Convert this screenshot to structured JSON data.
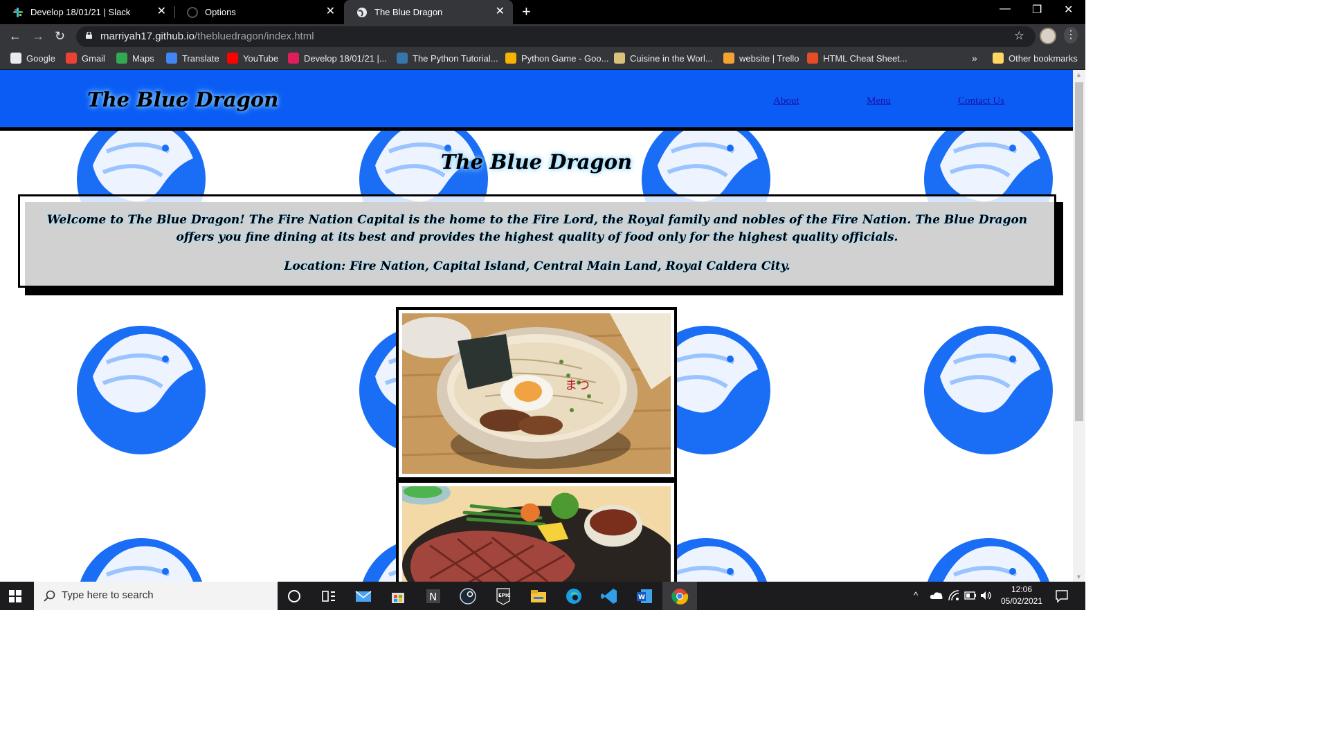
{
  "browser": {
    "tabs": [
      {
        "title": "Develop 18/01/21 | Slack",
        "active": false
      },
      {
        "title": "Options",
        "active": false
      },
      {
        "title": "The Blue Dragon",
        "active": true
      }
    ],
    "url_host": "marriyah17.github.io",
    "url_path": "/thebluedragon/index.html",
    "bookmarks": [
      {
        "label": "Google",
        "icon": "google-icon",
        "color": "#e8eaed"
      },
      {
        "label": "Gmail",
        "icon": "gmail-icon",
        "color": "#ea4335"
      },
      {
        "label": "Maps",
        "icon": "maps-icon",
        "color": "#34a853"
      },
      {
        "label": "Translate",
        "icon": "translate-icon",
        "color": "#4285f4"
      },
      {
        "label": "YouTube",
        "icon": "youtube-icon",
        "color": "#ff0000"
      },
      {
        "label": "Develop 18/01/21 |...",
        "icon": "slack-icon",
        "color": "#e01e5a"
      },
      {
        "label": "The Python Tutorial...",
        "icon": "python-icon",
        "color": "#3776ab"
      },
      {
        "label": "Python Game - Goo...",
        "icon": "slides-icon",
        "color": "#f4b400"
      },
      {
        "label": "Cuisine in the Worl...",
        "icon": "wiki-icon",
        "color": "#d9c37a"
      },
      {
        "label": "website | Trello",
        "icon": "trello-icon",
        "color": "#f4a233"
      },
      {
        "label": "HTML Cheat Sheet...",
        "icon": "html-icon",
        "color": "#e44d26"
      }
    ],
    "more_bookmarks": "»",
    "other_bookmarks": "Other bookmarks"
  },
  "site": {
    "brand": "The Blue Dragon",
    "nav": [
      "About",
      "Menu",
      "Contact Us"
    ],
    "title": "The Blue Dragon",
    "welcome": "Welcome to The Blue Dragon! The Fire Nation Capital is the home to the Fire Lord, the Royal family and nobles of the Fire Nation. The Blue Dragon offers you fine dining at its best and provides the highest quality of food only for the highest quality officials.",
    "location": "Location: Fire Nation, Capital Island, Central Main Land, Royal Caldera City.",
    "dishes": [
      {
        "name": "ramen-image"
      },
      {
        "name": "steak-image"
      }
    ],
    "colors": {
      "header": "#0b5cf4",
      "logo": "#1a6ef5"
    }
  },
  "taskbar": {
    "search_placeholder": "Type here to search",
    "time": "12:06",
    "date": "05/02/2021"
  }
}
